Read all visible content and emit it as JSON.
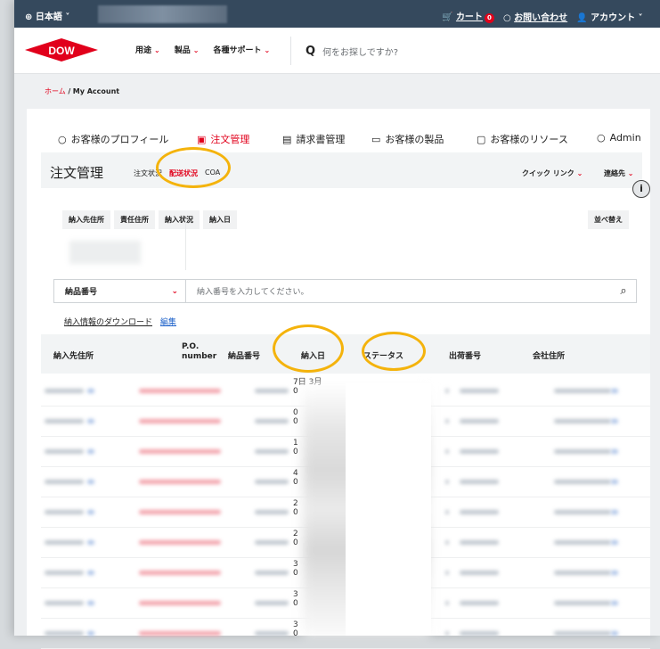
{
  "topbar": {
    "language": "⊕ 日本語 ˅",
    "cart": "カート",
    "cart_count": "0",
    "inquiry": "お問い合わせ",
    "account": "アカウント"
  },
  "header": {
    "logo": "DOW",
    "nav": [
      "用途",
      "製品",
      "各種サポート"
    ],
    "search_placeholder": "何をお探しですか?"
  },
  "breadcrumb": {
    "home": "ホーム",
    "sep": "/",
    "current": "My Account"
  },
  "tabs": [
    "お客様のプロフィール",
    "注文管理",
    "請求書管理",
    "お客様の製品",
    "お客様のリソース",
    "Admin"
  ],
  "subnav": {
    "title": "注文管理",
    "links": [
      "注文状況",
      "配送状況",
      "COA"
    ],
    "quick_links": "クイック リンク",
    "contact": "連絡先"
  },
  "filters": [
    "納入先住所",
    "責任住所",
    "納入状況",
    "納入日"
  ],
  "sort_label": "並べ替え",
  "search": {
    "field_select": "納品番号",
    "placeholder": "納入番号を入力してください。"
  },
  "download": {
    "label": "納入情報のダウンロード",
    "edit": "編集"
  },
  "table": {
    "headers": [
      "納入先住所",
      "P.O. number",
      "納品番号",
      "納入日",
      "ステータス",
      "出荷番号",
      "会社住所"
    ],
    "dates": [
      "7日 3月\n0",
      "0\n0",
      "1\n0",
      "4\n0",
      "2\n0",
      "2\n0",
      "3\n0",
      "3\n0",
      "3\n0"
    ]
  },
  "colors": {
    "brand_red": "#e1001b",
    "topbar": "#35495d",
    "highlight": "#f4b30c"
  }
}
